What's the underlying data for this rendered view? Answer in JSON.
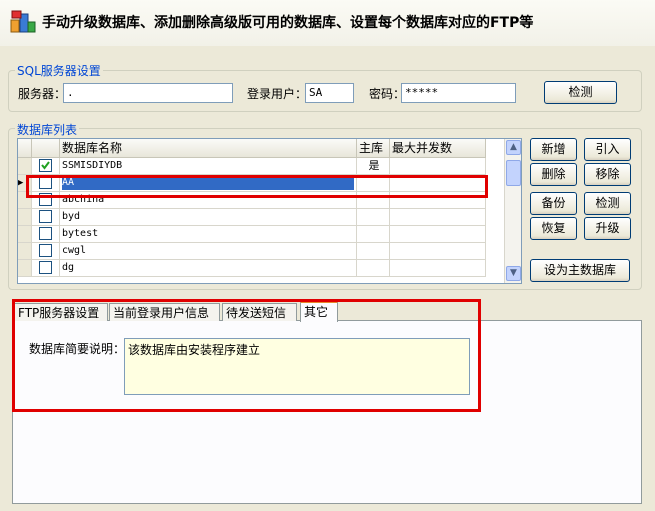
{
  "header": {
    "title": "手动升级数据库、添加删除高级版可用的数据库、设置每个数据库对应的FTP等"
  },
  "sql_settings": {
    "group_title": "SQL服务器设置",
    "server_label": "服务器：",
    "server_value": ".",
    "user_label": "登录用户：",
    "user_value": "SA",
    "password_label": "密码：",
    "password_value": "*****",
    "check_button": "检测"
  },
  "db_list": {
    "group_title": "数据库列表",
    "columns": [
      "数据库名称",
      "主库",
      "最大并发数"
    ],
    "rows": [
      {
        "name": "SSMISDIYDB",
        "checked": true,
        "main": "是",
        "max": ""
      },
      {
        "name": "AA",
        "checked": false,
        "main": "",
        "max": "",
        "selected": true
      },
      {
        "name": "abchina",
        "checked": false,
        "main": "",
        "max": ""
      },
      {
        "name": "byd",
        "checked": false,
        "main": "",
        "max": ""
      },
      {
        "name": "bytest",
        "checked": false,
        "main": "",
        "max": ""
      },
      {
        "name": "cwgl",
        "checked": false,
        "main": "",
        "max": ""
      },
      {
        "name": "dg",
        "checked": false,
        "main": "",
        "max": ""
      }
    ]
  },
  "actions": {
    "add": "新增",
    "import": "引入",
    "delete": "删除",
    "remove": "移除",
    "backup": "备份",
    "check": "检测",
    "restore": "恢复",
    "upgrade": "升级",
    "set_main": "设为主数据库"
  },
  "tabs": {
    "items": [
      "FTP服务器设置",
      "当前登录用户信息",
      "待发送短信",
      "其它"
    ],
    "active": 3
  },
  "other_tab": {
    "desc_label": "数据库简要说明：",
    "desc_value": "该数据库由安装程序建立"
  },
  "colors": {
    "highlight_border": "#e00000",
    "selection": "#316ac5",
    "group_title": "#0046d5",
    "textarea_bg": "#ffffe1"
  }
}
